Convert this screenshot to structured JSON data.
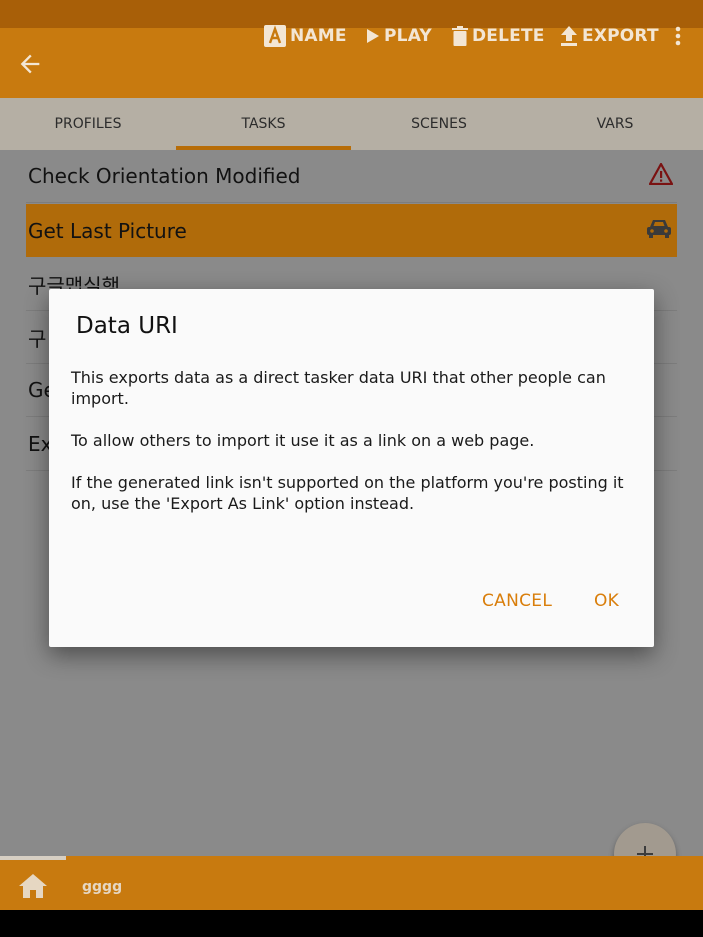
{
  "app_bar": {
    "actions": [
      {
        "label": "NAME",
        "icon": "name-icon"
      },
      {
        "label": "PLAY",
        "icon": "play-icon"
      },
      {
        "label": "DELETE",
        "icon": "trash-icon"
      },
      {
        "label": "EXPORT",
        "icon": "upload-icon"
      }
    ]
  },
  "tabs": [
    {
      "label": "PROFILES",
      "selected": false
    },
    {
      "label": "TASKS",
      "selected": true
    },
    {
      "label": "SCENES",
      "selected": false
    },
    {
      "label": "VARS",
      "selected": false
    }
  ],
  "tasks": [
    {
      "label": "Check Orientation Modified",
      "icon": "warning-icon",
      "selected": false
    },
    {
      "label": "Get Last Picture",
      "icon": "car-icon",
      "selected": true
    },
    {
      "label": "구글맵실행",
      "selected": false
    },
    {
      "label": "구",
      "selected": false
    },
    {
      "label": "Ge",
      "selected": false
    },
    {
      "label": "Ex",
      "selected": false
    }
  ],
  "dialog": {
    "title": "Data URI",
    "paragraphs": [
      "This exports data as a direct tasker data URI that other people can import.",
      "To allow others to import it use it as a link on a web page.",
      "If the generated link isn't supported on the platform you're posting it on, use the 'Export As Link' option instead."
    ],
    "cancel_label": "CANCEL",
    "ok_label": "OK"
  },
  "fab": {
    "icon": "plus-icon"
  },
  "bottom_bar": {
    "profile_label": "gggg",
    "icon": "home-icon"
  },
  "colors": {
    "accent": "#e58a0e",
    "dialog_button": "#d97e0b"
  }
}
